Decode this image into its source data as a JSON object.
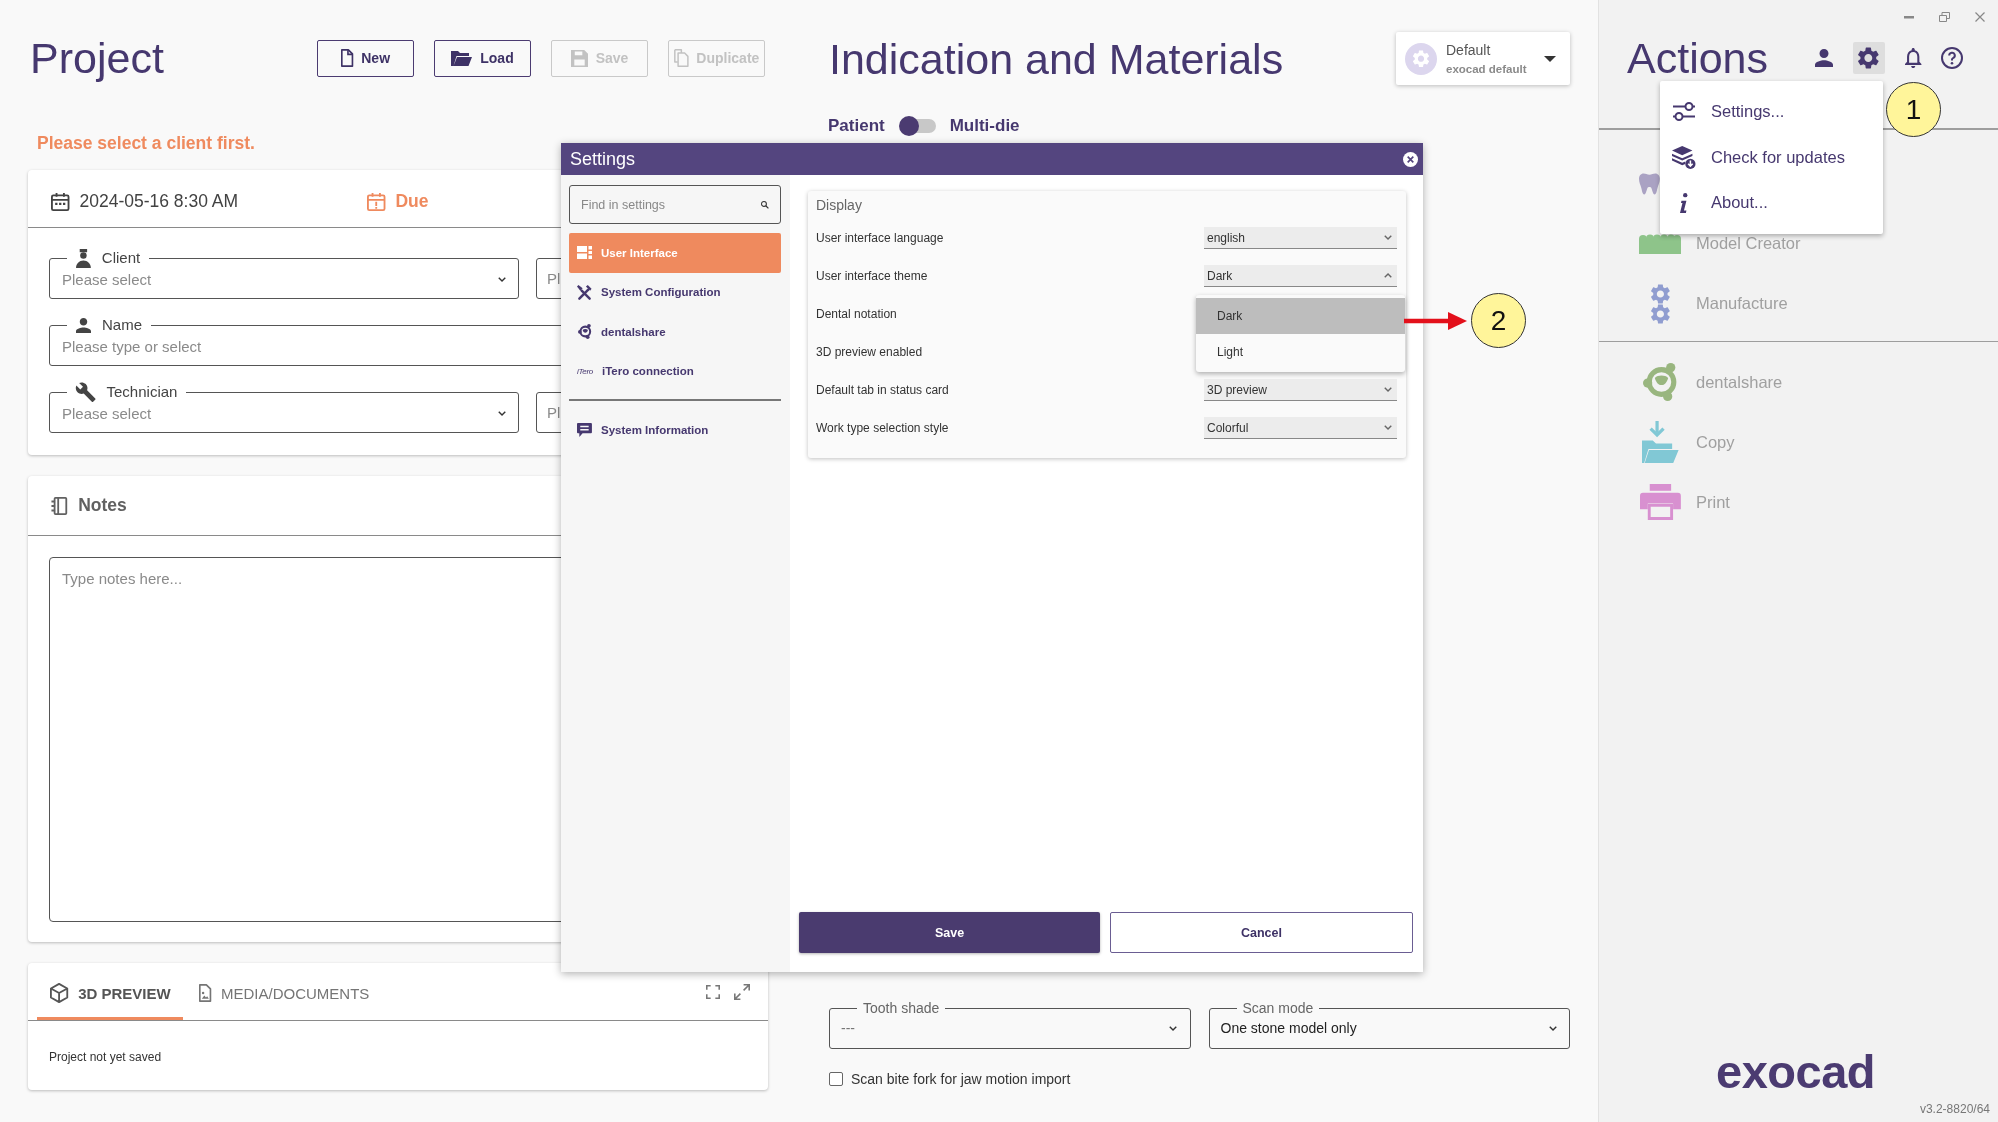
{
  "project": {
    "title": "Project",
    "toolbar": [
      {
        "label": "New",
        "disabled": false
      },
      {
        "label": "Load",
        "disabled": false
      },
      {
        "label": "Save",
        "disabled": true
      },
      {
        "label": "Duplicate",
        "disabled": true
      }
    ],
    "warning": "Please select a client first.",
    "schedule": {
      "date": "2024-05-16 8:30 AM",
      "due": "Due"
    },
    "fields": [
      {
        "label": "Client",
        "placeholder": "Please select",
        "kind": "select",
        "side_field": {
          "placeholder": "Pl"
        }
      },
      {
        "label": "Name",
        "placeholder": "Please type or select",
        "kind": "text"
      },
      {
        "label": "Technician",
        "placeholder": "Please select",
        "kind": "select",
        "side_field": {
          "placeholder": "Pl"
        }
      }
    ],
    "notes": {
      "title": "Notes",
      "placeholder": "Type notes here..."
    },
    "preview": {
      "tabs": [
        {
          "label": "3D PREVIEW",
          "selected": true
        },
        {
          "label": "MEDIA/DOCUMENTS",
          "selected": false
        }
      ],
      "status": "Project not yet saved"
    }
  },
  "indication": {
    "title": "Indication and Materials",
    "profile": {
      "name": "Default",
      "detail": "exocad default"
    },
    "mode_toggle": {
      "left": "Patient",
      "right": "Multi-die",
      "on": false
    },
    "tooth_shade": {
      "label": "Tooth shade",
      "placeholder": "---"
    },
    "scan_mode": {
      "label": "Scan mode",
      "value": "One stone model only"
    },
    "bite_fork": {
      "label": "Scan bite fork for jaw motion import",
      "checked": false
    }
  },
  "actions": {
    "title": "Actions",
    "groups": [
      {
        "items": [
          {
            "disabled": true
          },
          {
            "label": "Model Creator",
            "disabled": true
          },
          {
            "label": "Manufacture",
            "disabled": true
          }
        ]
      },
      {
        "items": [
          {
            "label": "dentalshare",
            "disabled": true
          },
          {
            "label": "Copy",
            "disabled": true
          },
          {
            "label": "Print",
            "disabled": true
          }
        ]
      }
    ],
    "brand": "exocad",
    "version": "v3.2-8820/64"
  },
  "settings_menu": {
    "open": true,
    "items": [
      {
        "label": "Settings..."
      },
      {
        "label": "Check for updates"
      },
      {
        "label": "About..."
      }
    ]
  },
  "settings_dialog": {
    "title": "Settings",
    "search": {
      "placeholder": "Find in settings"
    },
    "nav": [
      {
        "items": [
          {
            "label": "User Interface",
            "selected": true
          },
          {
            "label": "System Configuration",
            "selected": false
          },
          {
            "label": "dentalshare",
            "selected": false
          },
          {
            "label": "iTero connection",
            "selected": false,
            "logo": "iTero"
          }
        ]
      },
      {
        "items": [
          {
            "label": "System Information",
            "selected": false
          }
        ]
      }
    ],
    "section": {
      "title": "Display",
      "rows": [
        {
          "label": "User interface language",
          "value": "english",
          "expanded": false
        },
        {
          "label": "User interface theme",
          "value": "Dark",
          "expanded": true,
          "options": [
            {
              "label": "Dark",
              "selected": true
            },
            {
              "label": "Light",
              "selected": false
            }
          ]
        },
        {
          "label": "Dental notation"
        },
        {
          "label": "3D preview enabled"
        },
        {
          "label": "Default tab in status card",
          "value": "3D preview",
          "expanded": false
        },
        {
          "label": "Work type selection style",
          "value": "Colorful",
          "expanded": false
        }
      ]
    },
    "buttons": [
      {
        "label": "Save",
        "kind": "primary"
      },
      {
        "label": "Cancel",
        "kind": "secondary"
      }
    ]
  },
  "annotations": [
    {
      "label": "1",
      "arrow": false
    },
    {
      "label": "2",
      "arrow": true
    }
  ]
}
